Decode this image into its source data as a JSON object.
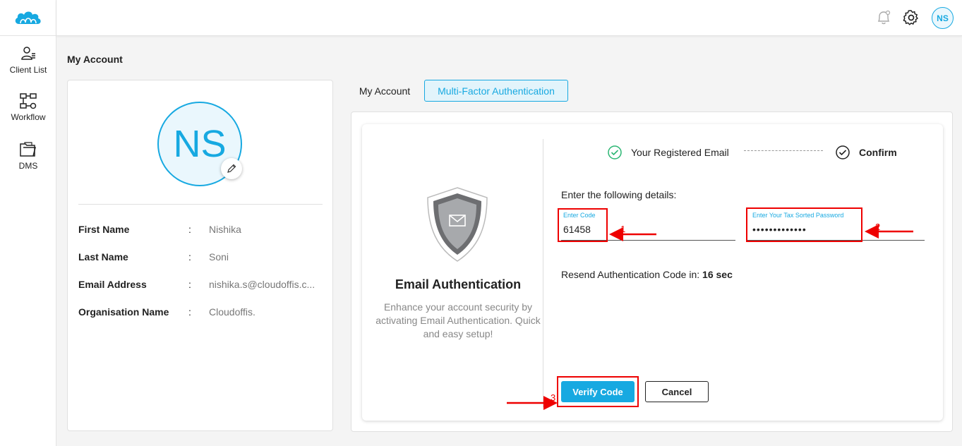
{
  "sidebar": {
    "items": [
      {
        "label": "Client List",
        "icon": "user-list-icon"
      },
      {
        "label": "Workflow",
        "icon": "workflow-icon"
      },
      {
        "label": "DMS",
        "icon": "folder-icon"
      }
    ]
  },
  "header": {
    "avatar_initials": "NS"
  },
  "page": {
    "title": "My Account"
  },
  "profile": {
    "initials": "NS",
    "rows": [
      {
        "label": "First Name",
        "colon": ":",
        "value": "Nishika"
      },
      {
        "label": "Last Name",
        "colon": ":",
        "value": "Soni"
      },
      {
        "label": "Email Address",
        "colon": ":",
        "value": "nishika.s@cloudoffis.c..."
      },
      {
        "label": "Organisation Name",
        "colon": ":",
        "value": "Cloudoffis."
      }
    ]
  },
  "tabs": [
    {
      "label": "My Account",
      "active": false
    },
    {
      "label": "Multi-Factor Authentication",
      "active": true
    }
  ],
  "mfa": {
    "title": "Email Authentication",
    "description": "Enhance your account security by activating Email Authentication. Quick and easy setup!",
    "steps": [
      {
        "label": "Your Registered Email",
        "status": "completed"
      },
      {
        "label": "Confirm",
        "status": "current"
      }
    ],
    "details_label": "Enter the following details:",
    "code_field": {
      "label": "Enter Code",
      "value": "61458"
    },
    "password_field": {
      "label": "Enter Your Tax Sorted Password",
      "value": "•••••••••••••"
    },
    "resend_prefix": "Resend Authentication Code in:",
    "resend_time": "16 sec",
    "verify_label": "Verify Code",
    "cancel_label": "Cancel"
  },
  "annotations": {
    "markers": [
      "1",
      "2",
      "3"
    ],
    "color": "#e00000"
  },
  "colors": {
    "accent": "#17a9e1",
    "success": "#2bb673"
  }
}
